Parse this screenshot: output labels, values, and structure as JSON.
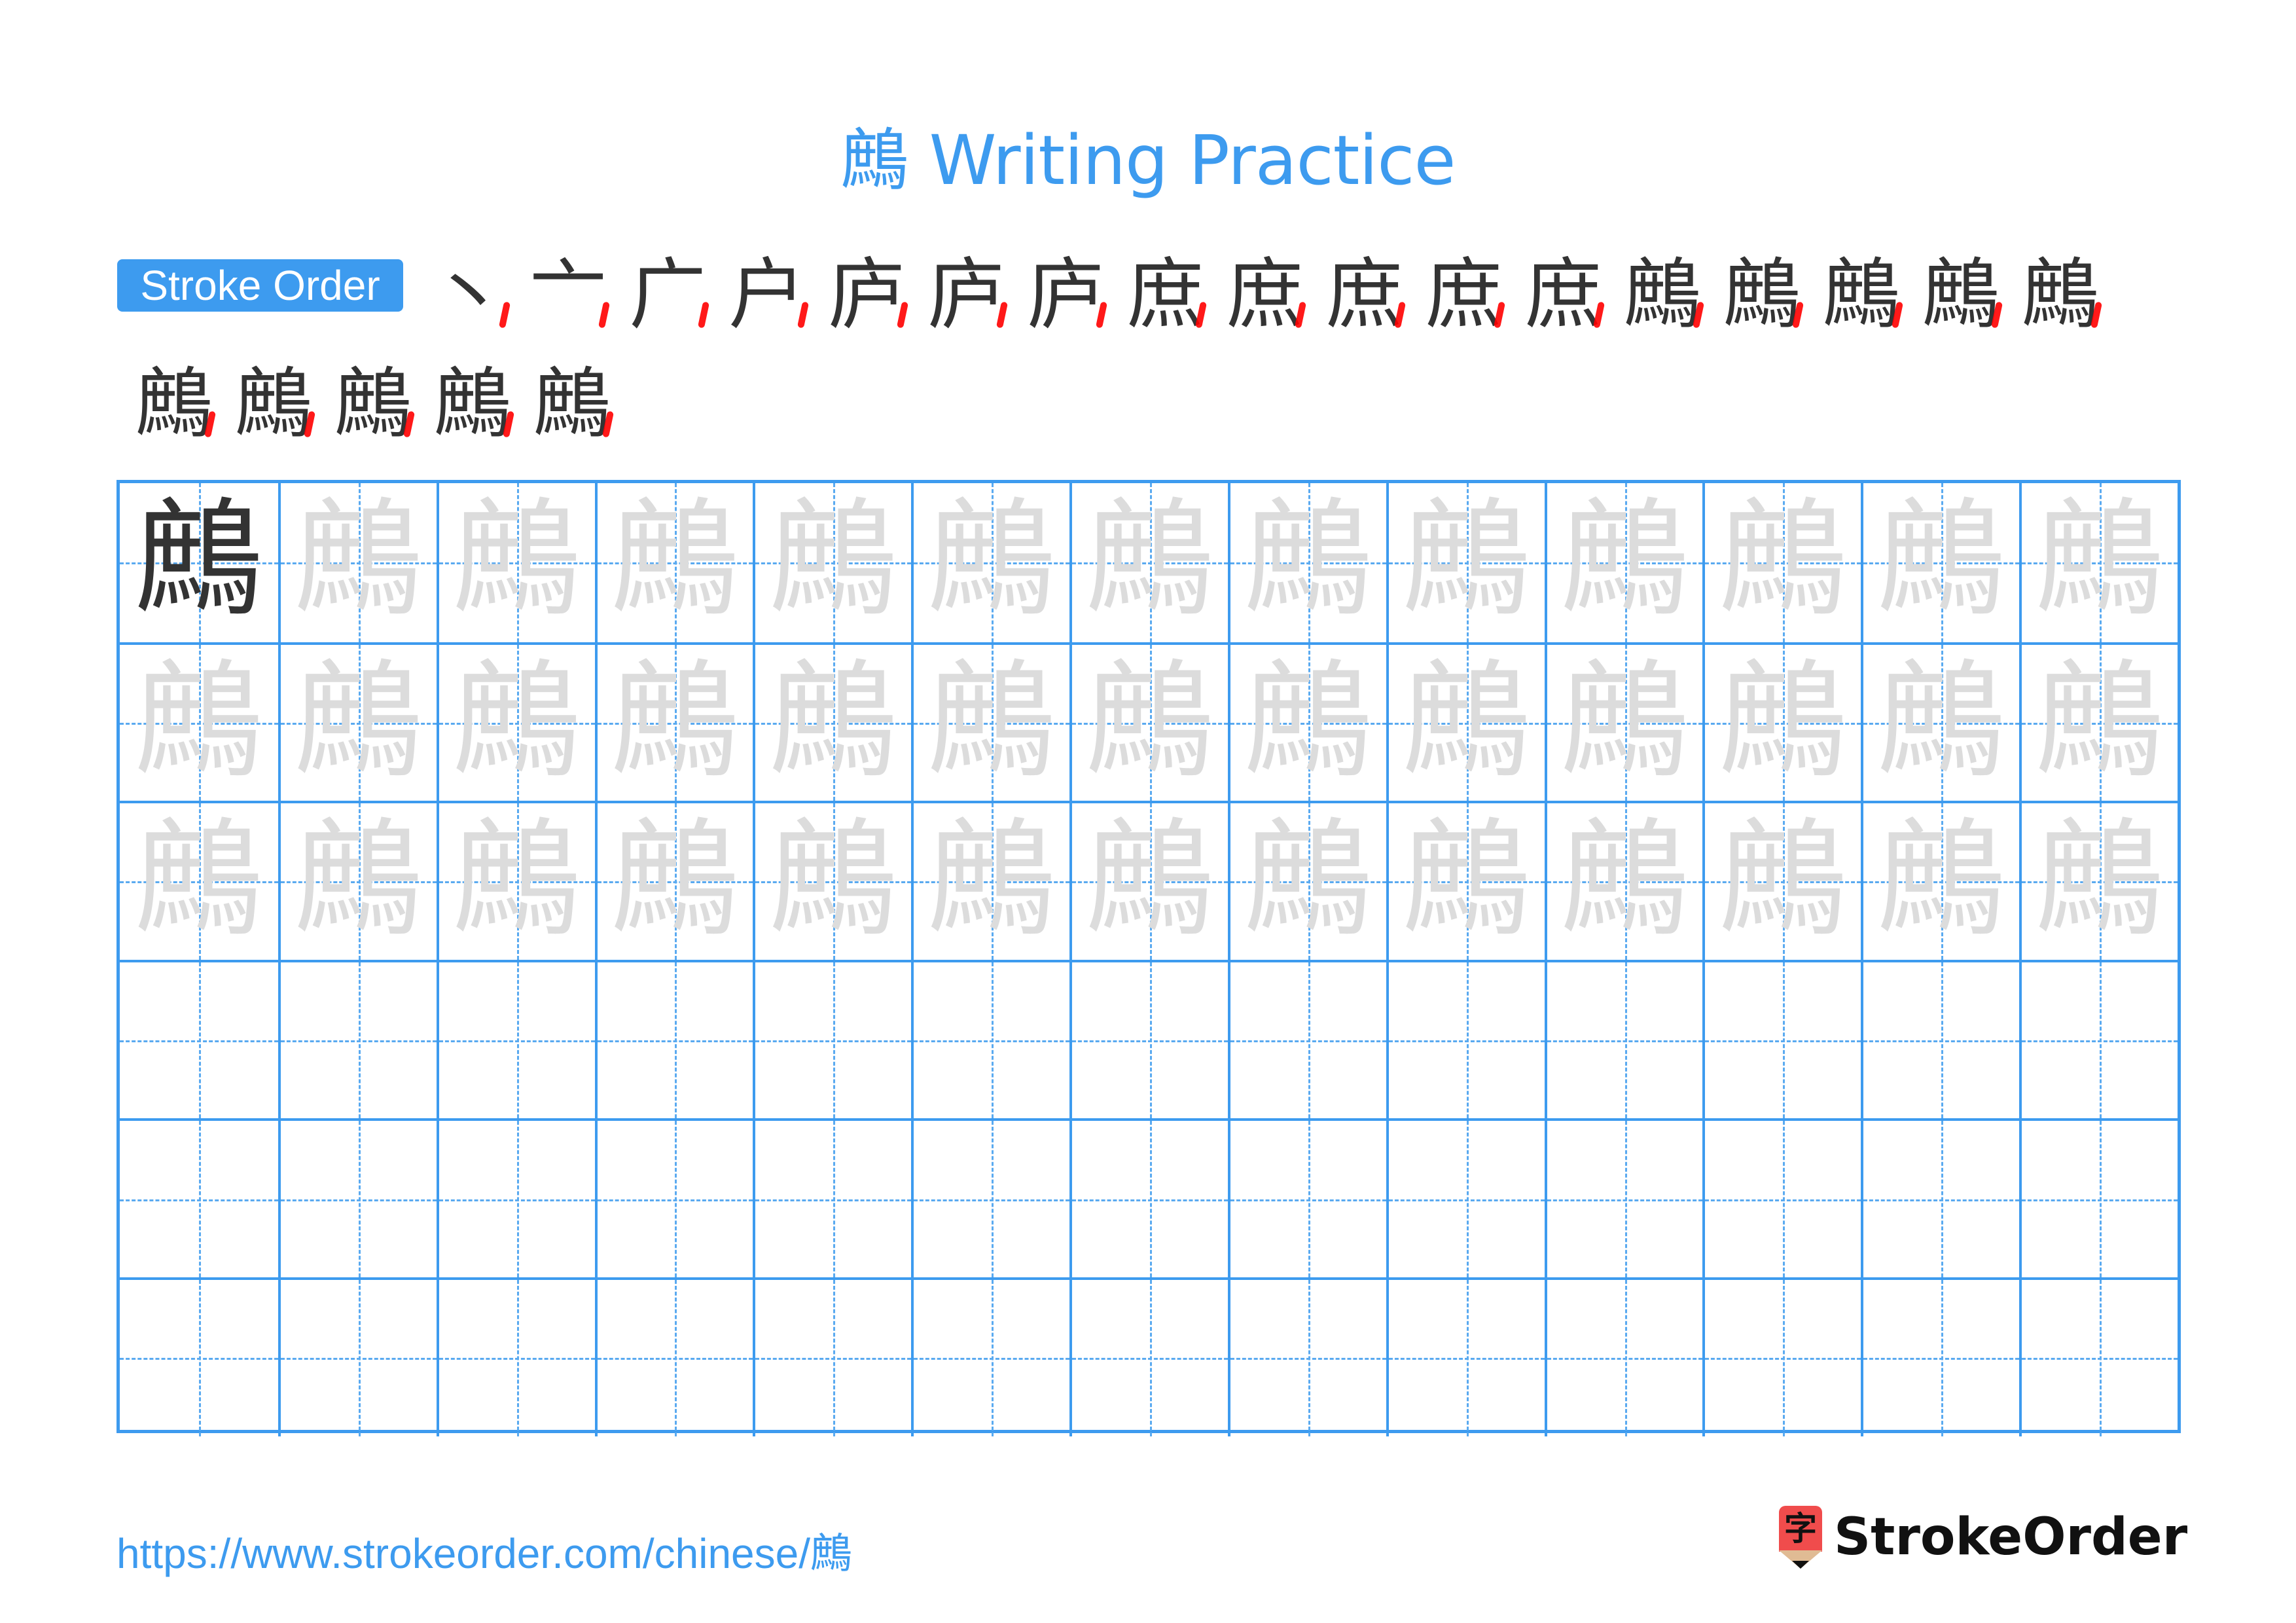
{
  "header": {
    "title": "鷓 Writing Practice"
  },
  "stroke_order": {
    "badge_label": "Stroke Order",
    "character": "鷓",
    "total_strokes": 22,
    "steps": [
      "丶",
      "亠",
      "广",
      "户",
      "庐",
      "庐",
      "庐",
      "庶",
      "庶",
      "庶",
      "庶",
      "庶",
      "鷓",
      "鷓",
      "鷓",
      "鷓",
      "鷓",
      "鷓",
      "鷓",
      "鷓",
      "鷓",
      "鷓"
    ],
    "highlight_color": "#ff0000",
    "stroke_color": "#333333"
  },
  "practice_grid": {
    "character": "鷓",
    "columns": 13,
    "rows": 6,
    "model_cells": 1,
    "trace_rows": 3,
    "empty_rows": 3,
    "grid_color": "#3d9bef",
    "trace_color": "#dcdcdc"
  },
  "footer": {
    "url": "https://www.strokeorder.com/chinese/鷓",
    "logo_text": "StrokeOrder",
    "logo_icon_glyph": "字"
  }
}
